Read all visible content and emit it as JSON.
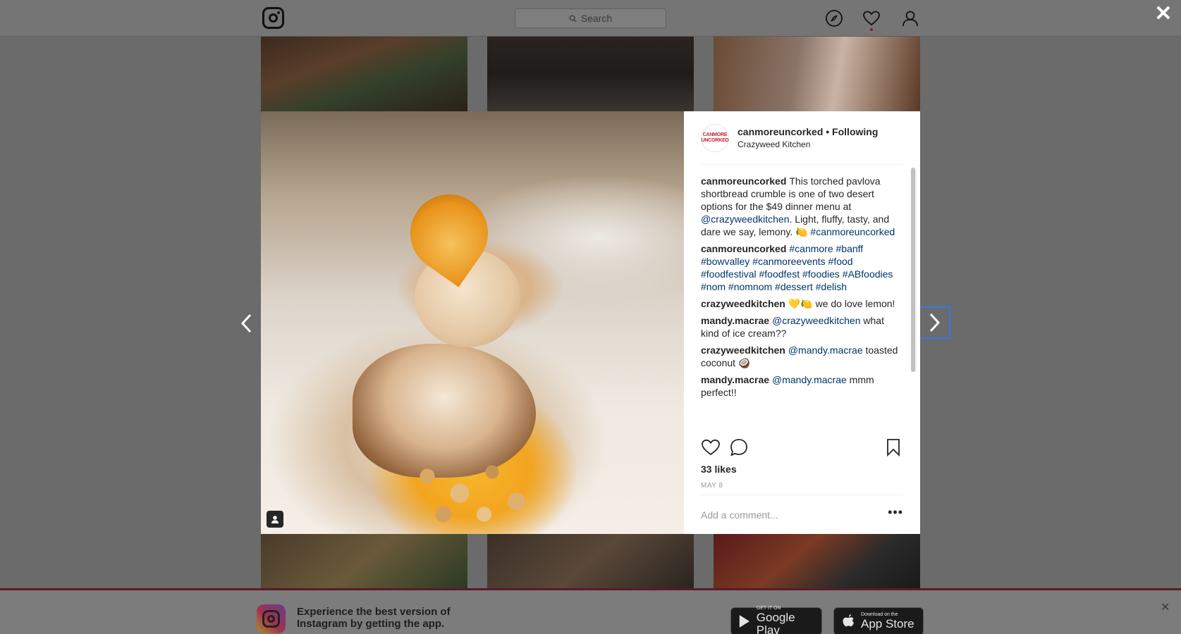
{
  "topbar": {
    "search_placeholder": "Search"
  },
  "modal": {
    "close_label": "✕",
    "post": {
      "avatar_text": "CANMORE UNCORKED",
      "username": "canmoreuncorked",
      "follow_status": "• Following",
      "location": "Crazyweed Kitchen",
      "comments": [
        {
          "user": "canmoreuncorked",
          "parts": [
            {
              "text": "This torched pavlova shortbread crumble is one of two desert options for the $49 dinner menu at ",
              "link": false
            },
            {
              "text": "@crazyweedkitchen",
              "link": true
            },
            {
              "text": ". Light, fluffy, tasty, and dare we say, lemony. 🍋 ",
              "link": false
            },
            {
              "text": "#canmoreuncorked",
              "link": true
            }
          ]
        },
        {
          "user": "canmoreuncorked",
          "parts": [
            {
              "text": "#canmore #banff #bowvalley #canmoreevents #food #foodfestival #foodfest #foodies #ABfoodies #nom #nomnom #dessert #delish",
              "link": true
            }
          ]
        },
        {
          "user": "crazyweedkitchen",
          "parts": [
            {
              "text": "💛🍋 we do love lemon!",
              "link": false
            }
          ]
        },
        {
          "user": "mandy.macrae",
          "parts": [
            {
              "text": "@crazyweedkitchen",
              "link": true
            },
            {
              "text": " what kind of ice cream??",
              "link": false
            }
          ]
        },
        {
          "user": "crazyweedkitchen",
          "parts": [
            {
              "text": "@mandy.macrae",
              "link": true
            },
            {
              "text": " toasted coconut 🥥",
              "link": false
            }
          ]
        },
        {
          "user": "mandy.macrae",
          "parts": [
            {
              "text": "@mandy.macrae",
              "link": true
            },
            {
              "text": " mmm perfect!!",
              "link": false
            }
          ]
        }
      ],
      "likes": "33 likes",
      "date": "MAY 8",
      "comment_placeholder": "Add a comment...",
      "more_label": "•••"
    }
  },
  "banner": {
    "line1": "Experience the best version of",
    "line2": "Instagram by getting the app.",
    "google_small": "GET IT ON",
    "google_big": "Google Play",
    "apple_small": "Download on the",
    "apple_big": "App Store",
    "close_label": "✕"
  },
  "icons": {
    "explore": "compass-icon",
    "activity": "heart-icon",
    "profile": "user-icon",
    "like": "heart-outline-icon",
    "comment": "speech-bubble-icon",
    "save": "bookmark-icon",
    "tagged": "person-tag-icon"
  },
  "colors": {
    "link": "#003569",
    "highlight_border": "#2f7be6",
    "banner_border": "#5b1a28"
  }
}
